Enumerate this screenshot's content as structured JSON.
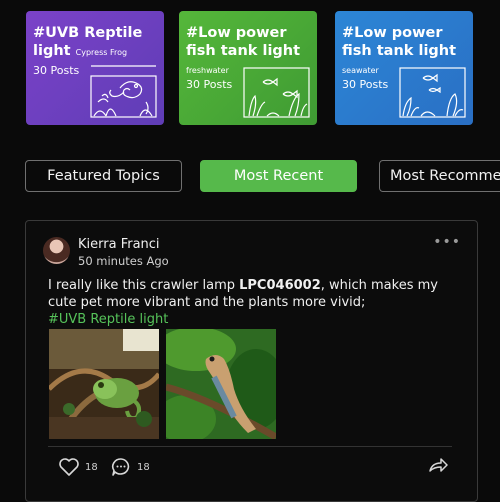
{
  "topic_cards": [
    {
      "title": "#UVB Reptile",
      "title_line2": "light",
      "subtitle": "Cypress Frog",
      "posts": "30 Posts",
      "art_icon": "chameleon-terrarium-icon",
      "color_start": "#7b42c8",
      "color_end": "#5f3db6"
    },
    {
      "title": "#Low power",
      "title_line2": "fish tank light",
      "subtitle": "freshwater",
      "posts": "30 Posts",
      "art_icon": "freshwater-aquarium-icon",
      "color_start": "#55b73a",
      "color_end": "#3f9b33"
    },
    {
      "title": "#Low power",
      "title_line2": "fish tank light",
      "subtitle": "seawater",
      "posts": "30 Posts",
      "art_icon": "saltwater-aquarium-icon",
      "color_start": "#2c86d6",
      "color_end": "#2a6fc4"
    }
  ],
  "tabs": [
    {
      "label": "Featured Topics",
      "active": false
    },
    {
      "label": "Most Recent",
      "active": true
    },
    {
      "label": "Most Recomme",
      "active": false
    }
  ],
  "colors": {
    "background": "#0a0a0a",
    "accent_green": "#56c35a",
    "active_tab": "#56b94b"
  },
  "post": {
    "author": "Kierra Franci",
    "time": "50 minutes Ago",
    "text_before": "I really like this crawler lamp ",
    "product_code": "LPC046002",
    "text_after": ", which makes my cute pet more vibrant and the plants more vivid;",
    "hashtag": "#UVB Reptile light",
    "images": [
      "chameleon-in-terrarium-photo",
      "lizard-on-branch-photo"
    ],
    "likes": "18",
    "comments": "18",
    "icons": {
      "like": "heart-icon",
      "comment": "comment-bubble-icon",
      "share": "share-arrow-icon",
      "more": "more-dots-icon"
    }
  }
}
